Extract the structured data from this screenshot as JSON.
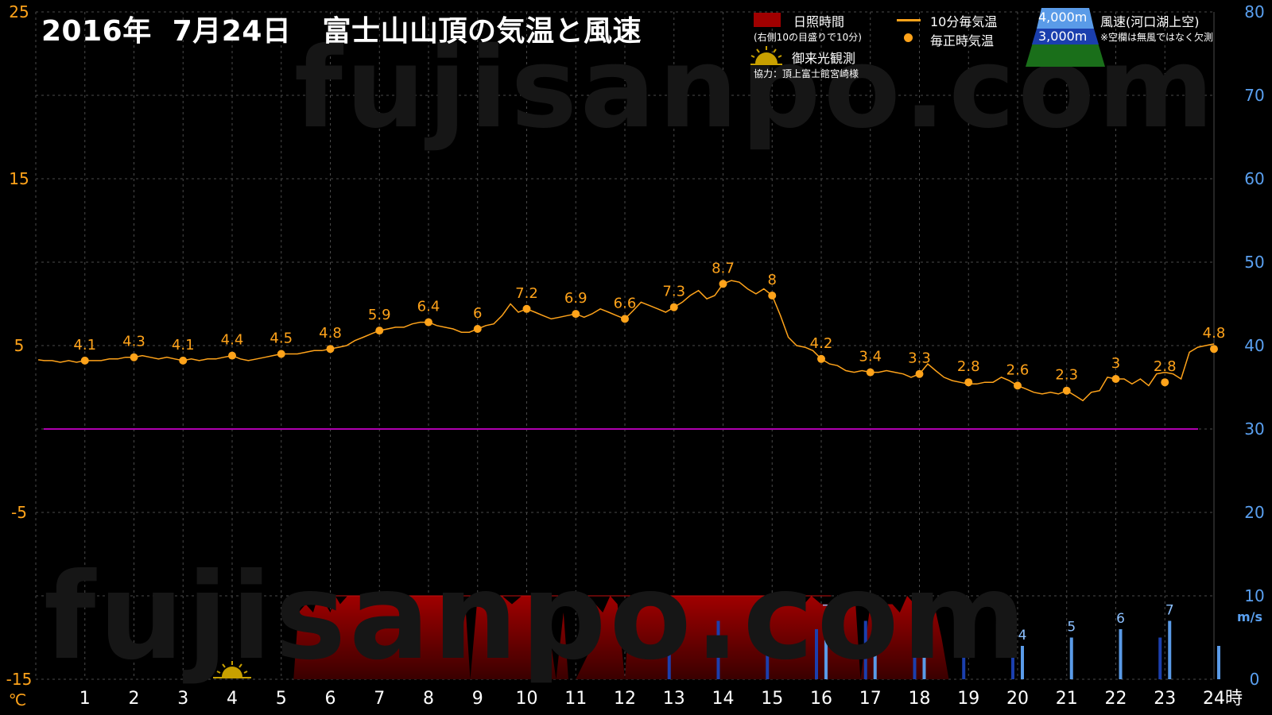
{
  "header": {
    "title": "2016年  7月24日   富士山山頂の気温と風速"
  },
  "watermark": "fujisanpo.com",
  "legend": {
    "sunshine_label": "日照時間",
    "sunshine_note": "(右側10の目盛りで10分)",
    "temp10_label": "10分毎気温",
    "temp_hourly_label": "毎正時気温",
    "goraiko_label": "御来光観測",
    "credit": "協力：頂上富士館宮崎様",
    "wind_4000_label": "4,000m",
    "wind_3000_label": "3,000m",
    "wind_title": "風速(河口湖上空)",
    "wind_note": "※空欄は無風ではなく欠測"
  },
  "colors": {
    "background": "#000000",
    "temperature": "#ffa31a",
    "sunshine": "#a00000",
    "wind_4000": "#5a9be8",
    "wind_3000": "#1b3fae",
    "zero_line": "#b000b0",
    "left_axis": "#ffa31a",
    "right_axis": "#5aa0f0",
    "grid": "#4a4a4a"
  },
  "chart_data": {
    "type": "line",
    "title": "2016年  7月24日   富士山山頂の気温と風速",
    "x_unit_label": "時",
    "y_left_unit_label": "℃",
    "y_right_unit_label": "m/s",
    "x_ticks": [
      "1",
      "2",
      "3",
      "4",
      "5",
      "6",
      "7",
      "8",
      "9",
      "10",
      "11",
      "12",
      "13",
      "14",
      "15",
      "16",
      "17",
      "18",
      "19",
      "20",
      "21",
      "22",
      "23",
      "24"
    ],
    "xlim": [
      0,
      24
    ],
    "y_left_ticks": [
      "25",
      "15",
      "5",
      "-5",
      "-15"
    ],
    "ylim_left": [
      -15,
      25
    ],
    "y_right_ticks": [
      "80",
      "70",
      "60",
      "50",
      "40",
      "30",
      "20",
      "10",
      "0"
    ],
    "ylim_right": [
      0,
      80
    ],
    "grid": true,
    "goraiko_hour": 4,
    "hourly_temperature": {
      "name": "毎正時気温",
      "x": [
        1,
        2,
        3,
        4,
        5,
        6,
        7,
        8,
        9,
        10,
        11,
        12,
        13,
        14,
        15,
        16,
        17,
        18,
        19,
        20,
        21,
        22,
        23,
        24
      ],
      "values": [
        4.1,
        4.3,
        4.1,
        4.4,
        4.5,
        4.8,
        5.9,
        6.4,
        6,
        7.2,
        6.9,
        6.6,
        7.3,
        8.7,
        8,
        4.2,
        3.4,
        3.3,
        2.8,
        2.6,
        2.3,
        3,
        2.8,
        4.8
      ],
      "labels": [
        "4.1",
        "4.3",
        "4.1",
        "4.4",
        "4.5",
        "4.8",
        "5.9",
        "6.4",
        "6",
        "7.2",
        "6.9",
        "6.6",
        "7.3",
        "8.7",
        "8",
        "4.2",
        "3.4",
        "3.3",
        "2.8",
        "2.6",
        "2.3",
        "3",
        "2.8",
        "4.8"
      ]
    },
    "ten_minute_temperature": {
      "name": "10分毎気温",
      "x": [
        0.17,
        0.33,
        0.5,
        0.67,
        0.83,
        1.0,
        1.17,
        1.33,
        1.5,
        1.67,
        1.83,
        2.0,
        2.17,
        2.33,
        2.5,
        2.67,
        2.83,
        3.0,
        3.17,
        3.33,
        3.5,
        3.67,
        3.83,
        4.0,
        4.17,
        4.33,
        4.5,
        4.67,
        4.83,
        5.0,
        5.17,
        5.33,
        5.5,
        5.67,
        5.83,
        6.0,
        6.17,
        6.33,
        6.5,
        6.67,
        6.83,
        7.0,
        7.17,
        7.33,
        7.5,
        7.67,
        7.83,
        8.0,
        8.17,
        8.33,
        8.5,
        8.67,
        8.83,
        9.0,
        9.17,
        9.33,
        9.5,
        9.67,
        9.83,
        10.0,
        10.17,
        10.33,
        10.5,
        10.67,
        10.83,
        11.0,
        11.17,
        11.33,
        11.5,
        11.67,
        11.83,
        12.0,
        12.17,
        12.33,
        12.5,
        12.67,
        12.83,
        13.0,
        13.17,
        13.33,
        13.5,
        13.67,
        13.83,
        14.0,
        14.17,
        14.33,
        14.5,
        14.67,
        14.83,
        15.0,
        15.17,
        15.33,
        15.5,
        15.67,
        15.83,
        16.0,
        16.17,
        16.33,
        16.5,
        16.67,
        16.83,
        17.0,
        17.17,
        17.33,
        17.5,
        17.67,
        17.83,
        18.0,
        18.17,
        18.33,
        18.5,
        18.67,
        18.83,
        19.0,
        19.17,
        19.33,
        19.5,
        19.67,
        19.83,
        20.0,
        20.17,
        20.33,
        20.5,
        20.67,
        20.83,
        21.0,
        21.17,
        21.33,
        21.5,
        21.67,
        21.83,
        22.0,
        22.17,
        22.33,
        22.5,
        22.67,
        22.83,
        23.0,
        23.17,
        23.33,
        23.5,
        23.67,
        23.83,
        24.0
      ],
      "values": [
        4.1,
        4.1,
        4.0,
        4.1,
        4.0,
        4.1,
        4.1,
        4.1,
        4.2,
        4.2,
        4.3,
        4.3,
        4.4,
        4.3,
        4.2,
        4.3,
        4.2,
        4.1,
        4.2,
        4.1,
        4.2,
        4.2,
        4.3,
        4.4,
        4.2,
        4.1,
        4.2,
        4.3,
        4.4,
        4.5,
        4.5,
        4.5,
        4.6,
        4.7,
        4.7,
        4.8,
        4.9,
        5.0,
        5.3,
        5.5,
        5.7,
        5.9,
        6.0,
        6.1,
        6.1,
        6.3,
        6.4,
        6.4,
        6.2,
        6.1,
        6.0,
        5.8,
        5.8,
        6.0,
        6.2,
        6.3,
        6.8,
        7.5,
        7.0,
        7.2,
        7.0,
        6.8,
        6.6,
        6.7,
        6.8,
        6.9,
        6.7,
        6.9,
        7.2,
        7.0,
        6.8,
        6.6,
        7.1,
        7.6,
        7.4,
        7.2,
        7.0,
        7.3,
        7.6,
        8.0,
        8.3,
        7.8,
        8.0,
        8.7,
        8.9,
        8.8,
        8.4,
        8.1,
        8.4,
        8.0,
        6.8,
        5.5,
        5.0,
        4.9,
        4.7,
        4.2,
        3.9,
        3.8,
        3.5,
        3.4,
        3.5,
        3.4,
        3.4,
        3.5,
        3.4,
        3.3,
        3.1,
        3.3,
        3.9,
        3.5,
        3.1,
        2.9,
        2.8,
        2.7,
        2.7,
        2.8,
        2.8,
        3.1,
        2.9,
        2.6,
        2.4,
        2.2,
        2.1,
        2.2,
        2.1,
        2.3,
        2.0,
        1.7,
        2.2,
        2.3,
        3.1,
        3.0,
        3.0,
        2.7,
        3.0,
        2.6,
        3.3,
        3.4,
        3.3,
        3.0,
        4.6,
        4.9,
        5.0,
        5.1,
        5.0,
        4.8
      ]
    },
    "sunshine_minutes": {
      "name": "日照時間",
      "x": [
        5.0,
        5.25,
        5.35,
        5.5,
        5.65,
        5.75,
        5.9,
        6.0,
        6.1,
        6.2,
        6.35,
        6.55,
        7.0,
        7.5,
        8.0,
        8.5,
        8.75,
        8.85,
        9.0,
        9.2,
        9.5,
        9.7,
        9.9,
        10.05,
        10.2,
        10.4,
        10.6,
        10.75,
        10.85,
        11.0,
        11.25,
        11.4,
        11.55,
        11.7,
        11.85,
        12.0,
        12.1,
        12.2,
        12.4,
        12.6,
        12.75,
        12.85,
        13.0,
        13.2,
        13.5,
        14.0,
        14.5,
        15.0,
        15.2,
        15.35,
        15.5,
        15.65,
        15.8,
        16.0,
        16.2,
        16.5,
        16.7,
        16.8,
        17.0,
        17.15,
        17.3,
        17.45,
        17.6,
        17.75,
        17.9,
        18.05,
        18.2,
        18.3,
        18.45,
        18.6
      ],
      "values": [
        0,
        0,
        8,
        9,
        8,
        10,
        9,
        8,
        10,
        9,
        10,
        10,
        10,
        10,
        10,
        10,
        9,
        0,
        10,
        9,
        10,
        9,
        10,
        10,
        10,
        8,
        0,
        8,
        0,
        0,
        3,
        9,
        8,
        10,
        9,
        0,
        9,
        10,
        10,
        10,
        10,
        10,
        10,
        10,
        10,
        10,
        10,
        10,
        9,
        10,
        10,
        9,
        10,
        9,
        9,
        9,
        9,
        0,
        9,
        8,
        9,
        9,
        8,
        10,
        9,
        10,
        8,
        9,
        5,
        0
      ]
    },
    "wind_speed": {
      "series": [
        {
          "name": "4,000m",
          "x": [
            16,
            17,
            18,
            20,
            21,
            22,
            23,
            24
          ],
          "values": [
            7,
            6,
            6,
            4,
            5,
            6,
            7,
            4
          ],
          "labels": [
            "7",
            "6",
            "6",
            "4",
            "5",
            "6",
            "7",
            ""
          ]
        },
        {
          "name": "3,000m",
          "x": [
            13,
            14,
            15,
            16,
            17,
            18,
            19,
            20,
            23
          ],
          "values": [
            5,
            7,
            8,
            6,
            7,
            6,
            6,
            8,
            5
          ]
        }
      ]
    }
  }
}
